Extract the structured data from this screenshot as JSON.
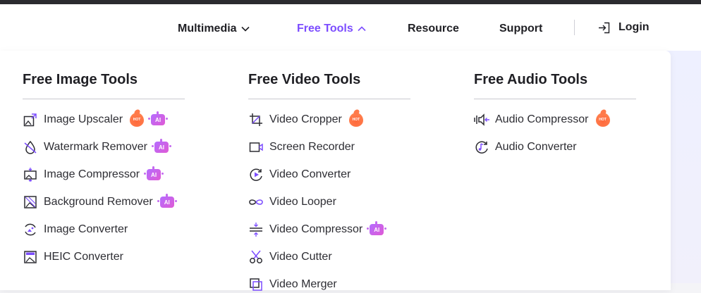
{
  "nav": {
    "multimedia": "Multimedia",
    "free_tools": "Free Tools",
    "resource": "Resource",
    "support": "Support",
    "login": "Login",
    "accent_color": "#7c4dff"
  },
  "image_tools": {
    "title": "Free Image Tools",
    "items": [
      {
        "label": "Image Upscaler",
        "icon": "image-upscale-icon",
        "badges": [
          "HOT",
          "AI"
        ]
      },
      {
        "label": "Watermark Remover",
        "icon": "watermark-drop-icon",
        "badges": [
          "AI"
        ]
      },
      {
        "label": "Image Compressor",
        "icon": "image-compress-icon",
        "badges": [
          "AI"
        ]
      },
      {
        "label": "Background Remover",
        "icon": "background-remove-icon",
        "badges": [
          "AI"
        ]
      },
      {
        "label": "Image Converter",
        "icon": "image-convert-icon",
        "badges": []
      },
      {
        "label": "HEIC Converter",
        "icon": "heic-icon",
        "badges": []
      }
    ]
  },
  "video_tools": {
    "title": "Free Video Tools",
    "items": [
      {
        "label": "Video Cropper",
        "icon": "crop-icon",
        "badges": [
          "HOT"
        ]
      },
      {
        "label": "Screen Recorder",
        "icon": "screen-record-icon",
        "badges": []
      },
      {
        "label": "Video Converter",
        "icon": "video-convert-icon",
        "badges": []
      },
      {
        "label": "Video Looper",
        "icon": "loop-icon",
        "badges": []
      },
      {
        "label": "Video Compressor",
        "icon": "video-compress-icon",
        "badges": [
          "AI"
        ]
      },
      {
        "label": "Video Cutter",
        "icon": "scissors-icon",
        "badges": []
      },
      {
        "label": "Video Merger",
        "icon": "merge-icon",
        "badges": []
      }
    ]
  },
  "audio_tools": {
    "title": "Free Audio Tools",
    "items": [
      {
        "label": "Audio Compressor",
        "icon": "audio-compress-icon",
        "badges": [
          "HOT"
        ]
      },
      {
        "label": "Audio Converter",
        "icon": "audio-convert-icon",
        "badges": []
      }
    ]
  },
  "badge_text": {
    "hot": "HOT",
    "ai": "AI"
  }
}
